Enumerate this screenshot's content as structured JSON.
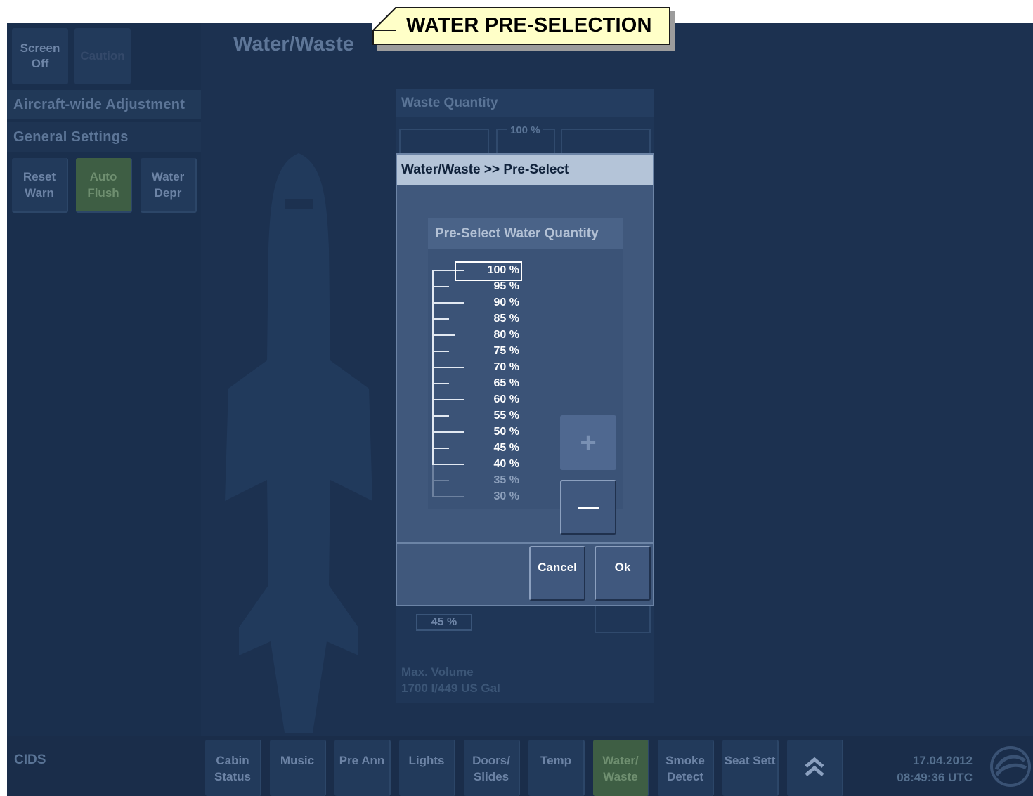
{
  "banner": {
    "title": "WATER PRE-SELECTION"
  },
  "top_buttons": {
    "screen_off": "Screen Off",
    "caution": "Caution"
  },
  "page_title": "Water/Waste",
  "sidebar": {
    "section_aircraft": "Aircraft-wide Adjustment",
    "section_general": "General Settings",
    "buttons": [
      {
        "label": "Reset Warn",
        "active": false
      },
      {
        "label": "Auto Flush",
        "active": true
      },
      {
        "label": "Water Depr",
        "active": false
      }
    ]
  },
  "waste_panel": {
    "header": "Waste Quantity",
    "top_scale_label": "100 %",
    "water_value": "45 %",
    "max_volume_line1": "Max. Volume",
    "max_volume_line2": "1700 l/449 US Gal"
  },
  "dialog": {
    "title": "Water/Waste >> Pre-Select",
    "panel_header": "Pre-Select Water Quantity",
    "selected_value": "100 %",
    "levels": [
      "100 %",
      "95 %",
      "90 %",
      "85 %",
      "80 %",
      "75 %",
      "70 %",
      "65 %",
      "60 %",
      "55 %",
      "50 %",
      "45 %",
      "40 %",
      "35 %",
      "30 %"
    ],
    "plus_label": "+",
    "minus_label": "—",
    "cancel_label": "Cancel",
    "ok_label": "Ok"
  },
  "bottom_bar": {
    "system_label": "CIDS",
    "nav": [
      {
        "label": "Cabin Status",
        "active": false
      },
      {
        "label": "Music",
        "active": false
      },
      {
        "label": "Pre Ann",
        "active": false
      },
      {
        "label": "Lights",
        "active": false
      },
      {
        "label": "Doors/ Slides",
        "active": false
      },
      {
        "label": "Temp",
        "active": false
      },
      {
        "label": "Water/ Waste",
        "active": true
      },
      {
        "label": "Smoke Detect",
        "active": false
      },
      {
        "label": "Seat Sett",
        "active": false
      }
    ],
    "expand_icon": "double-chevron-up-icon",
    "date": "17.04.2012",
    "time": "08:49:36 UTC"
  },
  "colors": {
    "background": "#1c3150",
    "active_button": "#3e5e44",
    "dialog_title_bar": "#b4c4d8",
    "banner": "#ffffc8"
  }
}
